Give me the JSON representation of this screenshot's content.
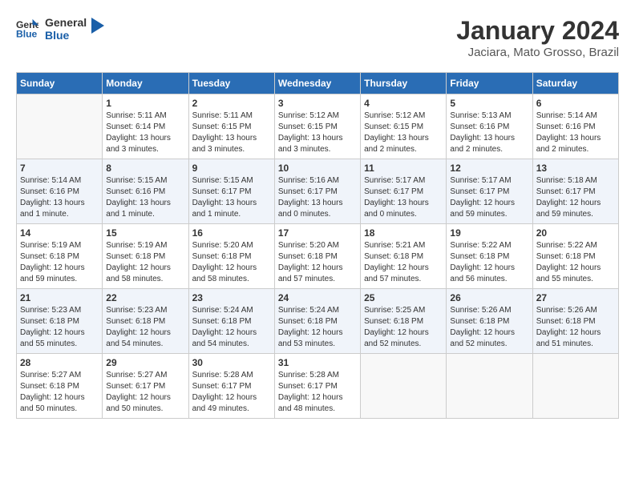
{
  "logo": {
    "text_general": "General",
    "text_blue": "Blue"
  },
  "title": "January 2024",
  "subtitle": "Jaciara, Mato Grosso, Brazil",
  "weekdays": [
    "Sunday",
    "Monday",
    "Tuesday",
    "Wednesday",
    "Thursday",
    "Friday",
    "Saturday"
  ],
  "weeks": [
    [
      {
        "day": "",
        "info": ""
      },
      {
        "day": "1",
        "info": "Sunrise: 5:11 AM\nSunset: 6:14 PM\nDaylight: 13 hours\nand 3 minutes."
      },
      {
        "day": "2",
        "info": "Sunrise: 5:11 AM\nSunset: 6:15 PM\nDaylight: 13 hours\nand 3 minutes."
      },
      {
        "day": "3",
        "info": "Sunrise: 5:12 AM\nSunset: 6:15 PM\nDaylight: 13 hours\nand 3 minutes."
      },
      {
        "day": "4",
        "info": "Sunrise: 5:12 AM\nSunset: 6:15 PM\nDaylight: 13 hours\nand 2 minutes."
      },
      {
        "day": "5",
        "info": "Sunrise: 5:13 AM\nSunset: 6:16 PM\nDaylight: 13 hours\nand 2 minutes."
      },
      {
        "day": "6",
        "info": "Sunrise: 5:14 AM\nSunset: 6:16 PM\nDaylight: 13 hours\nand 2 minutes."
      }
    ],
    [
      {
        "day": "7",
        "info": "Sunrise: 5:14 AM\nSunset: 6:16 PM\nDaylight: 13 hours\nand 1 minute."
      },
      {
        "day": "8",
        "info": "Sunrise: 5:15 AM\nSunset: 6:16 PM\nDaylight: 13 hours\nand 1 minute."
      },
      {
        "day": "9",
        "info": "Sunrise: 5:15 AM\nSunset: 6:17 PM\nDaylight: 13 hours\nand 1 minute."
      },
      {
        "day": "10",
        "info": "Sunrise: 5:16 AM\nSunset: 6:17 PM\nDaylight: 13 hours\nand 0 minutes."
      },
      {
        "day": "11",
        "info": "Sunrise: 5:17 AM\nSunset: 6:17 PM\nDaylight: 13 hours\nand 0 minutes."
      },
      {
        "day": "12",
        "info": "Sunrise: 5:17 AM\nSunset: 6:17 PM\nDaylight: 12 hours\nand 59 minutes."
      },
      {
        "day": "13",
        "info": "Sunrise: 5:18 AM\nSunset: 6:17 PM\nDaylight: 12 hours\nand 59 minutes."
      }
    ],
    [
      {
        "day": "14",
        "info": "Sunrise: 5:19 AM\nSunset: 6:18 PM\nDaylight: 12 hours\nand 59 minutes."
      },
      {
        "day": "15",
        "info": "Sunrise: 5:19 AM\nSunset: 6:18 PM\nDaylight: 12 hours\nand 58 minutes."
      },
      {
        "day": "16",
        "info": "Sunrise: 5:20 AM\nSunset: 6:18 PM\nDaylight: 12 hours\nand 58 minutes."
      },
      {
        "day": "17",
        "info": "Sunrise: 5:20 AM\nSunset: 6:18 PM\nDaylight: 12 hours\nand 57 minutes."
      },
      {
        "day": "18",
        "info": "Sunrise: 5:21 AM\nSunset: 6:18 PM\nDaylight: 12 hours\nand 57 minutes."
      },
      {
        "day": "19",
        "info": "Sunrise: 5:22 AM\nSunset: 6:18 PM\nDaylight: 12 hours\nand 56 minutes."
      },
      {
        "day": "20",
        "info": "Sunrise: 5:22 AM\nSunset: 6:18 PM\nDaylight: 12 hours\nand 55 minutes."
      }
    ],
    [
      {
        "day": "21",
        "info": "Sunrise: 5:23 AM\nSunset: 6:18 PM\nDaylight: 12 hours\nand 55 minutes."
      },
      {
        "day": "22",
        "info": "Sunrise: 5:23 AM\nSunset: 6:18 PM\nDaylight: 12 hours\nand 54 minutes."
      },
      {
        "day": "23",
        "info": "Sunrise: 5:24 AM\nSunset: 6:18 PM\nDaylight: 12 hours\nand 54 minutes."
      },
      {
        "day": "24",
        "info": "Sunrise: 5:24 AM\nSunset: 6:18 PM\nDaylight: 12 hours\nand 53 minutes."
      },
      {
        "day": "25",
        "info": "Sunrise: 5:25 AM\nSunset: 6:18 PM\nDaylight: 12 hours\nand 52 minutes."
      },
      {
        "day": "26",
        "info": "Sunrise: 5:26 AM\nSunset: 6:18 PM\nDaylight: 12 hours\nand 52 minutes."
      },
      {
        "day": "27",
        "info": "Sunrise: 5:26 AM\nSunset: 6:18 PM\nDaylight: 12 hours\nand 51 minutes."
      }
    ],
    [
      {
        "day": "28",
        "info": "Sunrise: 5:27 AM\nSunset: 6:18 PM\nDaylight: 12 hours\nand 50 minutes."
      },
      {
        "day": "29",
        "info": "Sunrise: 5:27 AM\nSunset: 6:17 PM\nDaylight: 12 hours\nand 50 minutes."
      },
      {
        "day": "30",
        "info": "Sunrise: 5:28 AM\nSunset: 6:17 PM\nDaylight: 12 hours\nand 49 minutes."
      },
      {
        "day": "31",
        "info": "Sunrise: 5:28 AM\nSunset: 6:17 PM\nDaylight: 12 hours\nand 48 minutes."
      },
      {
        "day": "",
        "info": ""
      },
      {
        "day": "",
        "info": ""
      },
      {
        "day": "",
        "info": ""
      }
    ]
  ]
}
